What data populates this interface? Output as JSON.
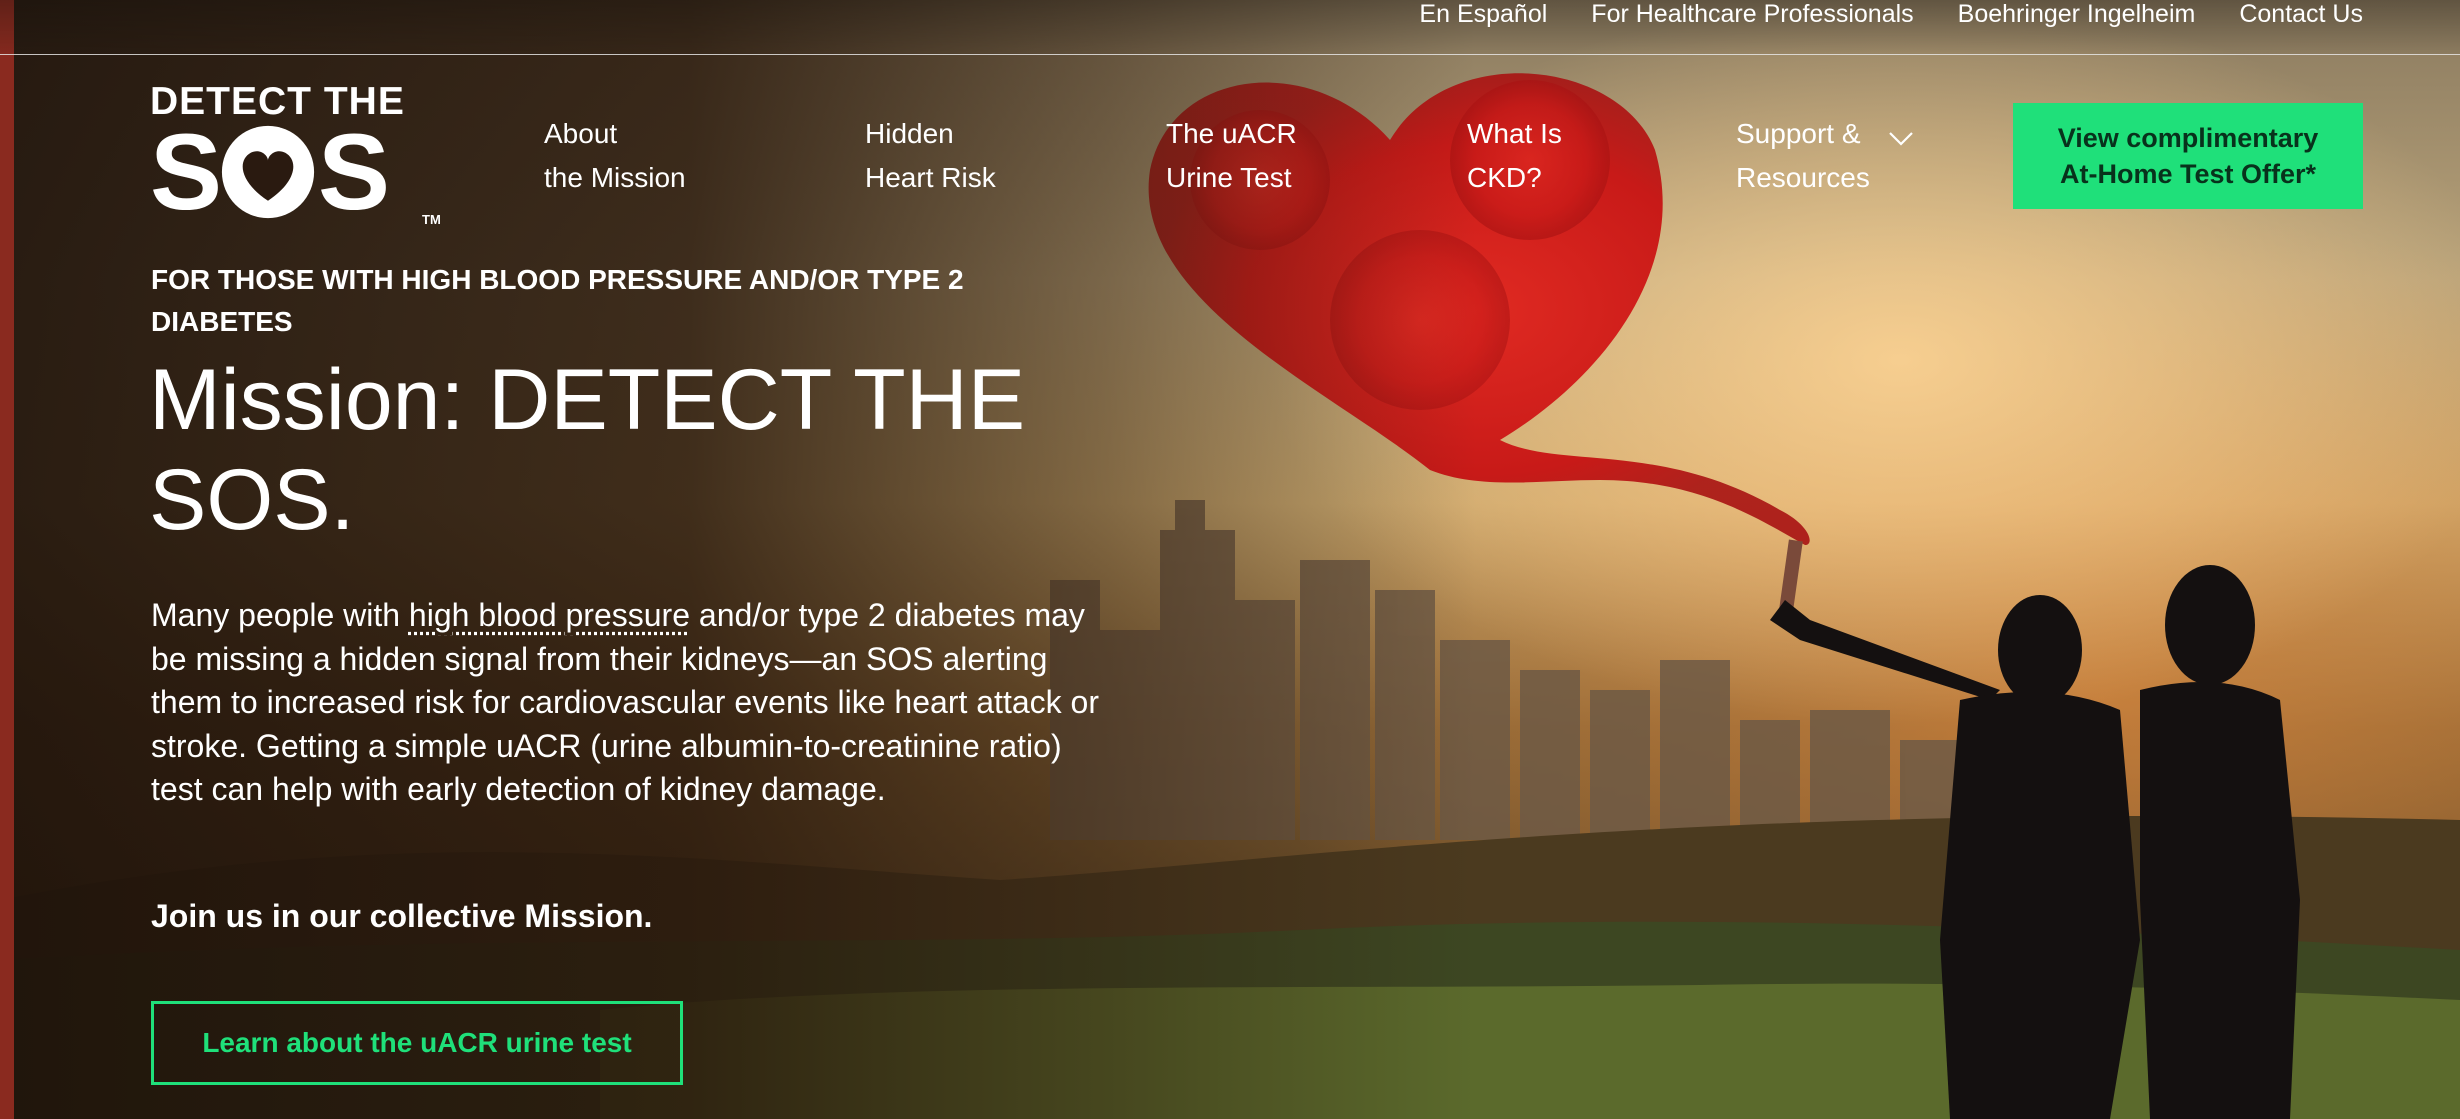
{
  "utility_nav": [
    "En Español",
    "For Healthcare Professionals",
    "Boehringer Ingelheim",
    "Contact Us"
  ],
  "logo": {
    "top": "DETECT THE",
    "s1": "S",
    "s2": "S",
    "tm": "TM",
    "icon": "heart-icon"
  },
  "nav": {
    "about": [
      "About",
      "the Mission"
    ],
    "hidden": [
      "Hidden",
      "Heart Risk"
    ],
    "uacr": [
      "The uACR",
      "Urine Test"
    ],
    "ckd": [
      "What Is",
      "CKD?"
    ],
    "support": [
      "Support &",
      "Resources"
    ],
    "support_icon": "chevron-down-icon"
  },
  "cta_top": [
    "View complimentary",
    "At-Home Test Offer*"
  ],
  "hero": {
    "eyebrow": "FOR THOSE WITH HIGH BLOOD PRESSURE AND/OR TYPE 2 DIABETES",
    "headline": "Mission: DETECT THE SOS.",
    "body_pre": "Many people with ",
    "body_link": "high blood pressure",
    "body_post": " and/or type 2 diabetes may be missing a hidden signal from their kidneys—an SOS alerting them to increased risk for cardiovascular events like heart attack or stroke. Getting a simple uACR (urine albumin-to-creatinine ratio) test can help with early detection of kidney damage.",
    "join": "Join us in our collective Mission.",
    "button": "Learn about the uACR urine test"
  },
  "colors": {
    "accent": "#1fe07a",
    "cta_text": "#08321c",
    "smoke": "#d21f1f"
  }
}
